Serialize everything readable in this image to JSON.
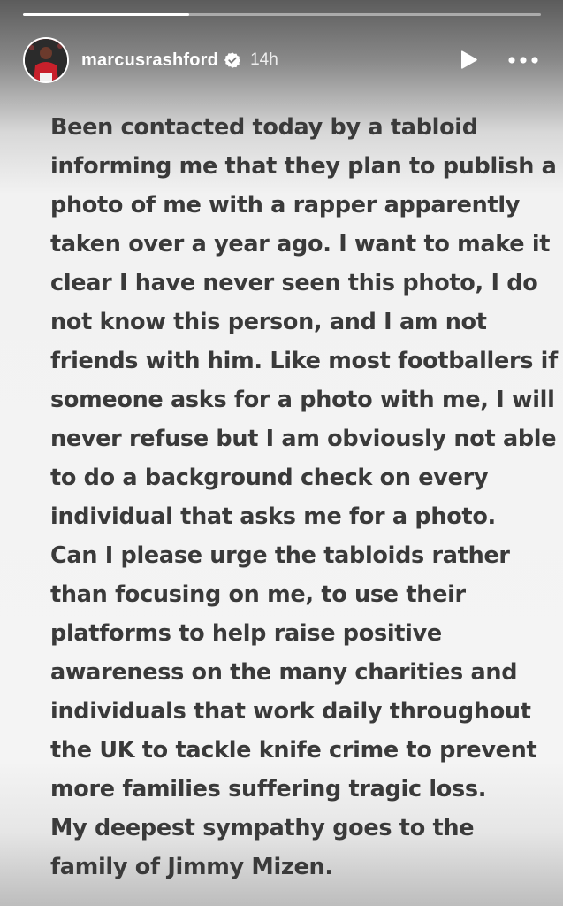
{
  "progress": {
    "fraction": 0.32
  },
  "header": {
    "username": "marcusrashford",
    "time_ago": "14h",
    "verified_icon": "verified-badge-icon",
    "play_icon": "play-icon",
    "more_icon": "more-options-icon"
  },
  "colors": {
    "text": "#3a3a3a",
    "header_text": "#ffffff"
  },
  "story": {
    "lines": [
      "Been contacted today by a tabloid",
      "informing me that they plan to publish a",
      "photo of me with a rapper apparently",
      "taken over a year ago. I want to make it",
      "clear I have never seen this photo, I do",
      "not know this person, and I am not",
      "friends with him. Like most footballers if",
      "someone asks for a photo with me, I will",
      "never refuse but I am obviously not able",
      "to do a background check on every",
      "individual that asks me for a photo.",
      "Can I please urge the tabloids rather",
      "than focusing on me, to use their",
      "platforms to help raise positive",
      "awareness on the many charities and",
      "individuals that work daily throughout",
      "the UK to tackle knife crime to prevent",
      "more families suffering tragic loss.",
      "My deepest sympathy goes to the",
      "family of Jimmy Mizen."
    ]
  }
}
